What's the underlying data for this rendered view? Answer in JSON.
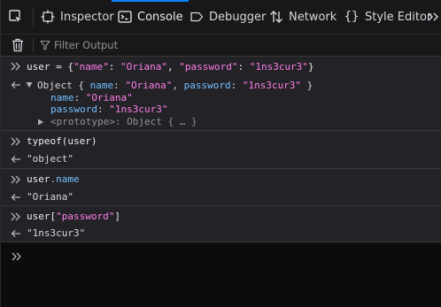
{
  "toolbar": {
    "tabs": [
      {
        "label": "Inspector",
        "icon": "inspector-icon",
        "selected": false
      },
      {
        "label": "Console",
        "icon": "console-icon",
        "selected": true
      },
      {
        "label": "Debugger",
        "icon": "debugger-icon",
        "selected": false
      },
      {
        "label": "Network",
        "icon": "network-icon",
        "selected": false
      },
      {
        "label": "Style Editor",
        "icon": "style-editor-icon",
        "selected": false
      }
    ],
    "accent": "#0a84ff"
  },
  "filter": {
    "placeholder": "Filter Output",
    "value": ""
  },
  "console": {
    "entries": [
      {
        "input": {
          "t1": "user = {",
          "t2": "\"name\"",
          "t3": ": ",
          "t4": "\"Oriana\"",
          "t5": ", ",
          "t6": "\"password\"",
          "t7": ": ",
          "t8": "\"1ns3cur3\"",
          "t9": "}"
        },
        "output": {
          "summary": {
            "t1": "Object { ",
            "t2": "name",
            "t3": ": ",
            "t4": "\"Oriana\"",
            "t5": ", ",
            "t6": "password",
            "t7": ": ",
            "t8": "\"1ns3cur3\"",
            "t9": " }"
          },
          "props": [
            {
              "key": "name",
              "sep": ": ",
              "value": "\"Oriana\""
            },
            {
              "key": "password",
              "sep": ": ",
              "value": "\"1ns3cur3\""
            }
          ],
          "proto": {
            "label": "<prototype>",
            "sep": ": ",
            "value": "Object { … }"
          }
        }
      },
      {
        "input": {
          "t1": "typeof(user)"
        },
        "output": {
          "value": "\"object\""
        }
      },
      {
        "input": {
          "t1": "user",
          "t2": ".name"
        },
        "output": {
          "value": "\"Oriana\""
        }
      },
      {
        "input": {
          "t1": "user[",
          "t2": "\"password\"",
          "t3": "]"
        },
        "output": {
          "value": "\"1ns3cur3\""
        }
      }
    ],
    "input_value": ""
  },
  "colors": {
    "string": "#ff7de9",
    "property": "#75bfff",
    "background": "#232327",
    "separator": "#38383d"
  }
}
